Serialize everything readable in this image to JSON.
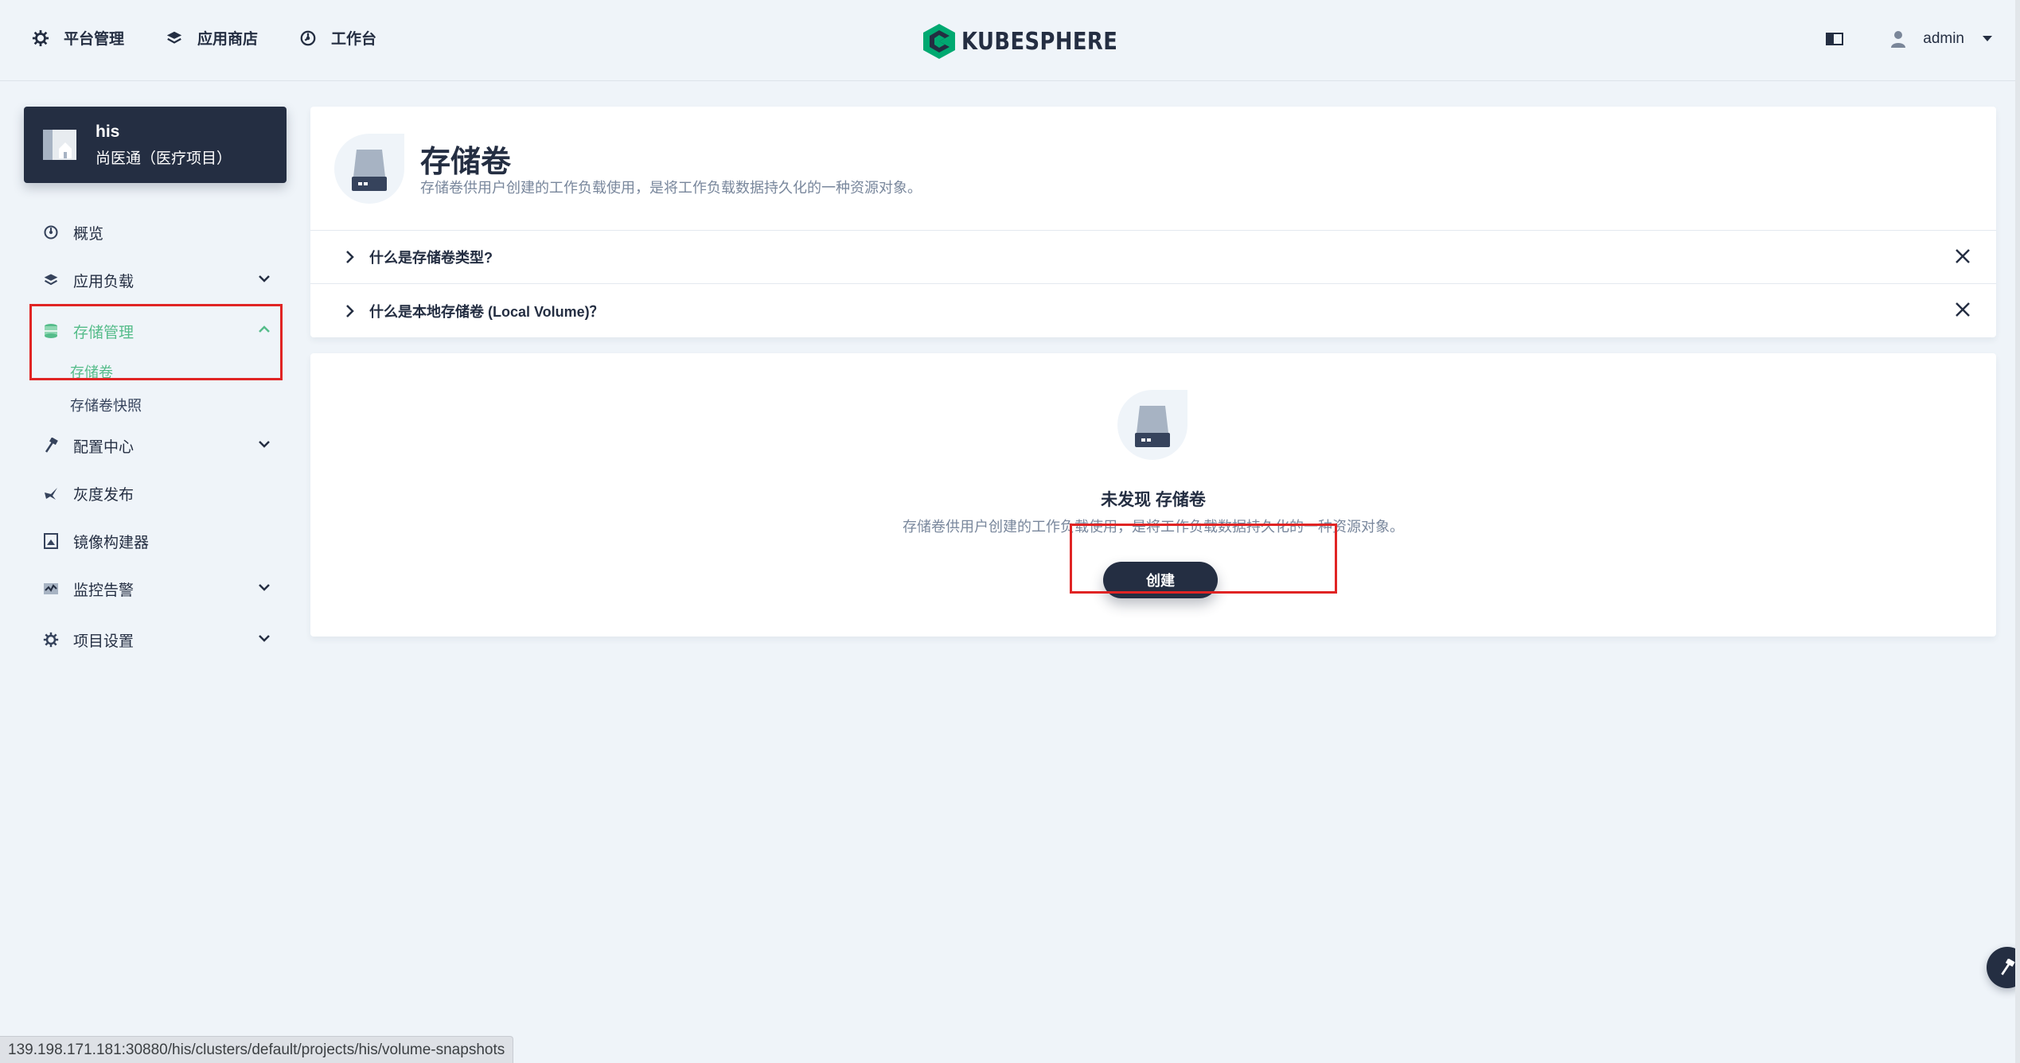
{
  "topnav": {
    "platform": "平台管理",
    "appstore": "应用商店",
    "workbench": "工作台",
    "logo_text": "KUBESPHERE",
    "user": "admin"
  },
  "project": {
    "name": "his",
    "desc": "尚医通（医疗项目）"
  },
  "sidebar": {
    "overview": "概览",
    "workloads": "应用负载",
    "storage": "存储管理",
    "volumes": "存储卷",
    "snapshots": "存储卷快照",
    "config": "配置中心",
    "grayscale": "灰度发布",
    "image_builder": "镜像构建器",
    "monitoring": "监控告警",
    "settings": "项目设置"
  },
  "header": {
    "title": "存储卷",
    "desc": "存储卷供用户创建的工作负载使用，是将工作负载数据持久化的一种资源对象。"
  },
  "faq": [
    {
      "q": "什么是存储卷类型?"
    },
    {
      "q": "什么是本地存储卷 (Local Volume)？"
    }
  ],
  "empty": {
    "title": "未发现 存储卷",
    "desc": "存储卷供用户创建的工作负载使用，是将工作负载数据持久化的一种资源对象。",
    "button": "创建"
  },
  "status_url": "139.198.171.181:30880/his/clusters/default/projects/his/volume-snapshots",
  "colors": {
    "dark": "#242e42",
    "accent": "#55bc8a",
    "annotation": "#e02424"
  }
}
